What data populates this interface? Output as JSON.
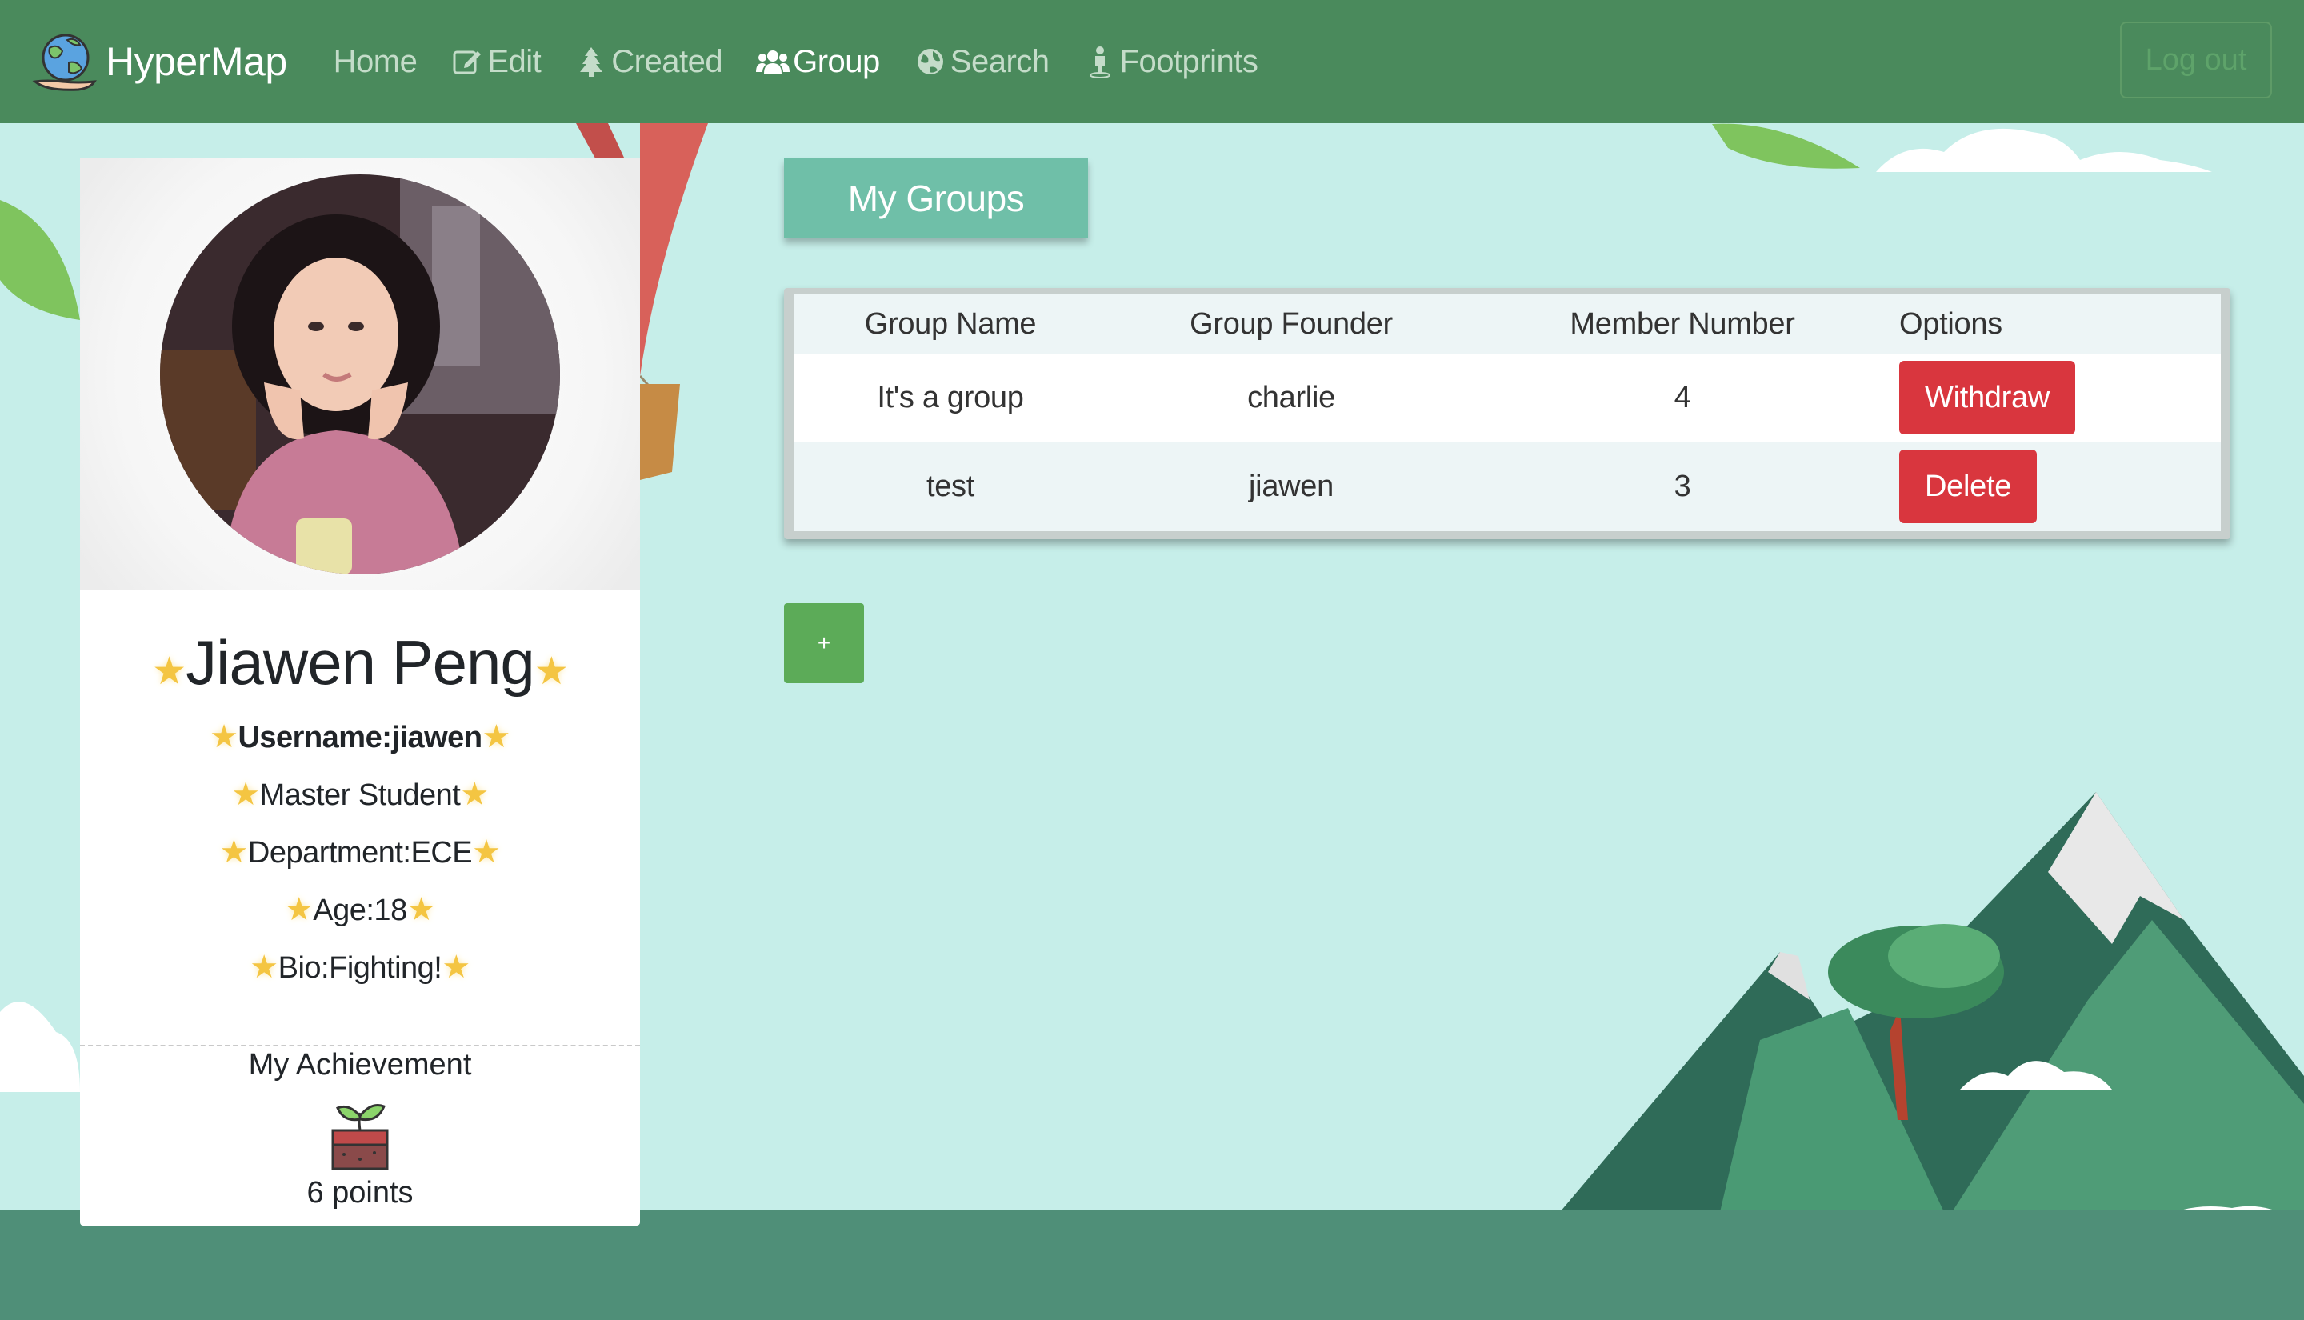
{
  "navbar": {
    "brand": "HyperMap",
    "links": [
      {
        "label": "Home",
        "icon": "none"
      },
      {
        "label": "Edit",
        "icon": "edit-icon"
      },
      {
        "label": "Created",
        "icon": "tree-icon"
      },
      {
        "label": "Group",
        "icon": "users-icon"
      },
      {
        "label": "Search",
        "icon": "globe-icon"
      },
      {
        "label": "Footprints",
        "icon": "person-icon"
      }
    ],
    "active": "Group",
    "logout": "Log out"
  },
  "profile": {
    "name": "Jiawen Peng",
    "username": "Username:jiawen",
    "role": "Master Student",
    "department": "Department:ECE",
    "age": "Age:18",
    "bio": "Bio:Fighting!",
    "achievement_title": "My Achievement",
    "points": "6 points"
  },
  "groups": {
    "header": "My Groups",
    "columns": [
      "Group Name",
      "Group Founder",
      "Member Number",
      "Options"
    ],
    "rows": [
      {
        "name": "It's a group",
        "founder": "charlie",
        "members": "4",
        "action": "Withdraw"
      },
      {
        "name": "test",
        "founder": "jiawen",
        "members": "3",
        "action": "Delete"
      }
    ],
    "add_label": "+"
  },
  "colors": {
    "navbar": "#4a8a5c",
    "background": "#c6eee9",
    "header": "#6fbfa8",
    "danger": "#d9363e",
    "add": "#5cab58"
  }
}
